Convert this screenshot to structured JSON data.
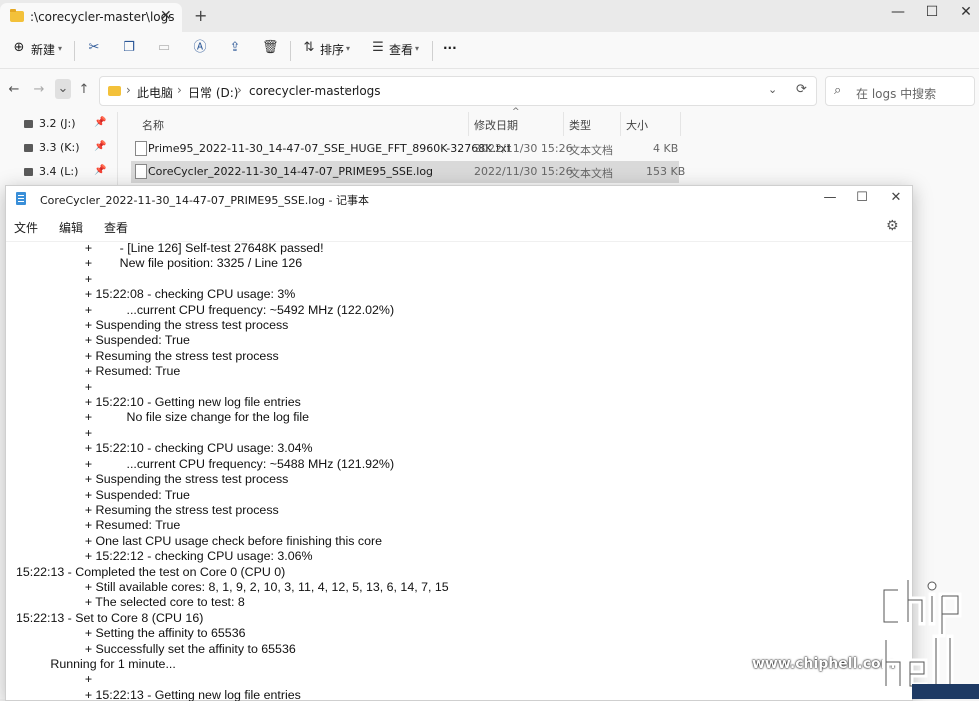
{
  "explorer": {
    "tab": {
      "title": ":\\corecycler-master\\logs"
    },
    "window_controls": {
      "minimize": "—",
      "maximize": "☐",
      "close": "✕"
    },
    "toolbar": {
      "new_label": "新建",
      "sort_label": "排序",
      "view_label": "查看",
      "more_label": "···"
    },
    "breadcrumb": [
      "此电脑",
      "日常 (D:)",
      "corecycler-master",
      "logs"
    ],
    "search": {
      "placeholder": "在 logs 中搜索"
    },
    "sidebar": {
      "items": [
        {
          "label": "3.2 (J:)"
        },
        {
          "label": "3.3 (K:)"
        },
        {
          "label": "3.4 (L:)"
        }
      ]
    },
    "columns": {
      "name": "名称",
      "modified": "修改日期",
      "type": "类型",
      "size": "大小"
    },
    "files": [
      {
        "name": "Prime95_2022-11-30_14-47-07_SSE_HUGE_FFT_8960K-32768K.txt",
        "modified": "2022/11/30 15:26",
        "type": "文本文档",
        "size": "4 KB"
      },
      {
        "name": "CoreCycler_2022-11-30_14-47-07_PRIME95_SSE.log",
        "modified": "2022/11/30 15:26",
        "type": "文本文档",
        "size": "153 KB"
      }
    ]
  },
  "notepad": {
    "title": "CoreCycler_2022-11-30_14-47-07_PRIME95_SSE.log - 记事本",
    "menu": {
      "file": "文件",
      "edit": "编辑",
      "view": "查看"
    },
    "lines": [
      "                    +        - [Line 126] Self-test 27648K passed!",
      "                    +        New file position: 3325 / Line 126",
      "                    +",
      "                    + 15:22:08 - checking CPU usage: 3%",
      "                    +          ...current CPU frequency: ~5492 MHz (122.02%)",
      "                    + Suspending the stress test process",
      "                    + Suspended: True",
      "                    + Resuming the stress test process",
      "                    + Resumed: True",
      "                    +",
      "                    + 15:22:10 - Getting new log file entries",
      "                    +          No file size change for the log file",
      "                    +",
      "                    + 15:22:10 - checking CPU usage: 3.04%",
      "                    +          ...current CPU frequency: ~5488 MHz (121.92%)",
      "                    + Suspending the stress test process",
      "                    + Suspended: True",
      "                    + Resuming the stress test process",
      "                    + Resumed: True",
      "                    + One last CPU usage check before finishing this core",
      "                    + 15:22:12 - checking CPU usage: 3.06%",
      "15:22:13 - Completed the test on Core 0 (CPU 0)",
      "                    + Still available cores: 8, 1, 9, 2, 10, 3, 11, 4, 12, 5, 13, 6, 14, 7, 15",
      "                    + The selected core to test: 8",
      "15:22:13 - Set to Core 8 (CPU 16)",
      "                    + Setting the affinity to 65536",
      "                    + Successfully set the affinity to 65536",
      "          Running for 1 minute...",
      "                    +",
      "                    + 15:22:13 - Getting new log file entries"
    ]
  },
  "watermark": {
    "url": "www.chiphell.com",
    "logo_text": "chip hell"
  }
}
